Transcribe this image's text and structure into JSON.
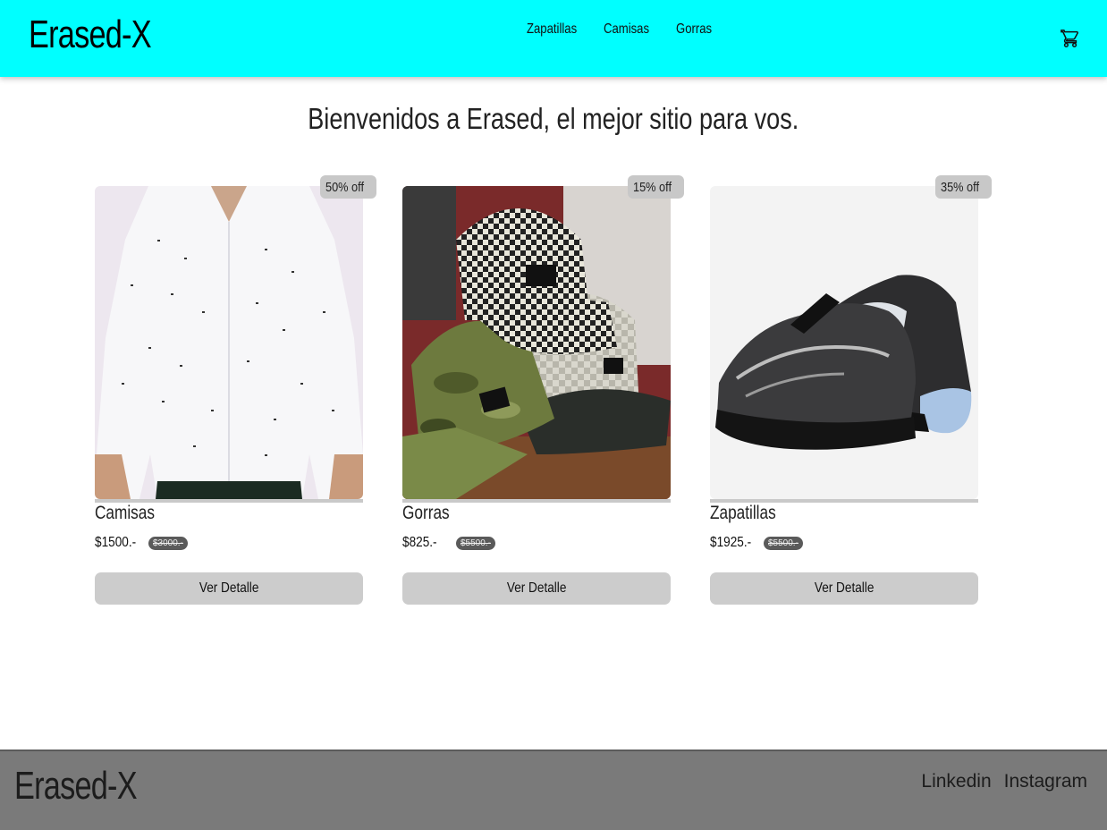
{
  "header": {
    "brand": "Erased-X",
    "nav": [
      "Zapatillas",
      "Camisas",
      "Gorras"
    ],
    "cart_icon": "shopping-cart-icon"
  },
  "hero": {
    "title": "Bienvenidos a Erased, el mejor sitio para vos."
  },
  "products": [
    {
      "name": "Camisas",
      "badge": "50% off",
      "price": "$1500.-",
      "old_price": "$3000.-",
      "button": "Ver Detalle",
      "image": "white-shirt-image"
    },
    {
      "name": "Gorras",
      "badge": "15% off",
      "price": "$825.-",
      "old_price": "$5500.-",
      "button": "Ver Detalle",
      "image": "caps-image"
    },
    {
      "name": "Zapatillas",
      "badge": "35% off",
      "price": "$1925.-",
      "old_price": "$5500.-",
      "button": "Ver Detalle",
      "image": "sneakers-image"
    }
  ],
  "footer": {
    "brand": "Erased-X",
    "links": [
      "Linkedin",
      "Instagram"
    ]
  },
  "colors": {
    "header_bg": "#00ffff",
    "footer_bg": "#7a7a7a",
    "button_bg": "#cccccc",
    "badge_bg": "#c8c8c8"
  }
}
